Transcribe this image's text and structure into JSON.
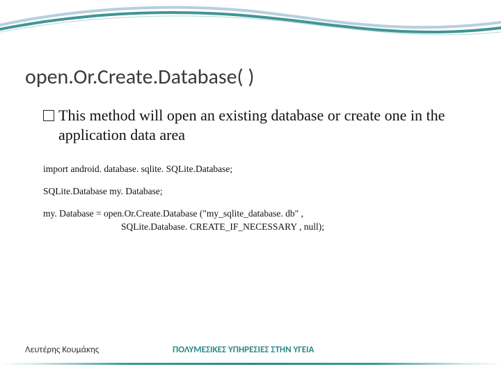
{
  "title": "open.Or.Create.Database( )",
  "bullet": "This method will open an existing database or create one in the application data area",
  "code": {
    "line1": "import android. database. sqlite. SQLite.Database;",
    "line2": "SQLite.Database  my. Database;",
    "line3a": "my. Database = open.Or.Create.Database (\"my_sqlite_database. db\"  ,",
    "line3b": "SQLite.Database. CREATE_IF_NECESSARY , null);"
  },
  "footer": {
    "author": "Λευτέρης Κουμάκης",
    "subject": "ΠΟΛΥΜΕΣΙΚΕΣ ΥΠΗΡΕΣΙΕΣ ΣΤΗΝ ΥΓΕΙΑ"
  }
}
